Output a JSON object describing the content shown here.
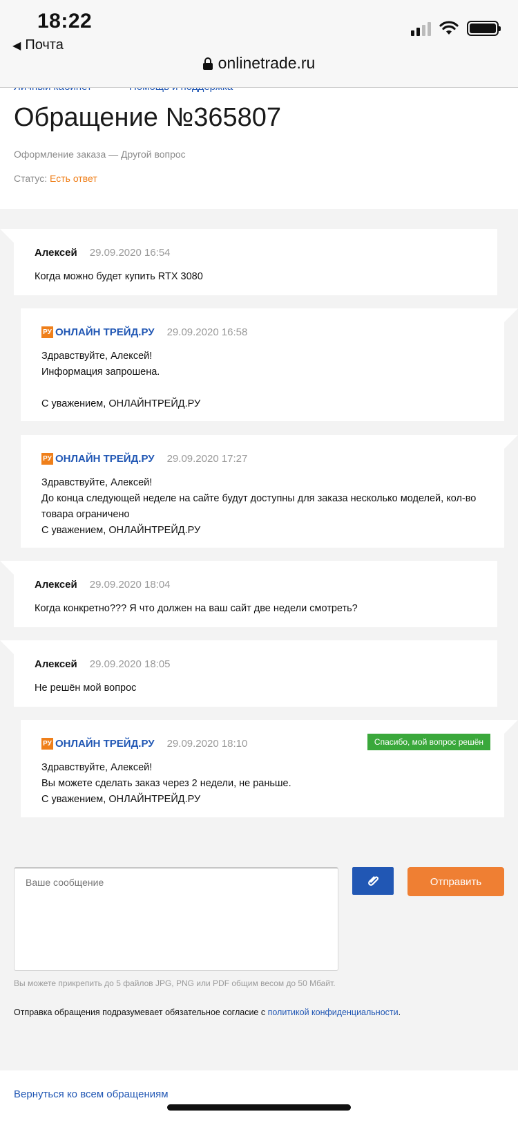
{
  "status_bar": {
    "time": "18:22",
    "back_app": "Почта",
    "url": "onlinetrade.ru"
  },
  "breadcrumbs": [
    "Личный кабинет",
    "Помощь и поддержка"
  ],
  "ticket": {
    "title": "Обращение №365807",
    "subtitle": "Оформление заказа — Другой вопрос",
    "status_label": "Статус:",
    "status_value": "Есть ответ",
    "status_color": "#ef7f1a"
  },
  "messages": [
    {
      "type": "user",
      "author": "Алексей",
      "date": "29.09.2020 16:54",
      "lines": [
        "Когда можно будет купить RTX 3080"
      ]
    },
    {
      "type": "support",
      "logo": "РУ",
      "author": "ОНЛАЙН ТРЕЙД.РУ",
      "date": "29.09.2020 16:58",
      "lines": [
        "Здравствуйте, Алексей!",
        "Информация запрошена.",
        "",
        "С уважением, ОНЛАЙНТРЕЙД.РУ"
      ]
    },
    {
      "type": "support",
      "logo": "РУ",
      "author": "ОНЛАЙН ТРЕЙД.РУ",
      "date": "29.09.2020 17:27",
      "lines": [
        "Здравствуйте, Алексей!",
        "До конца следующей неделе на сайте будут доступны для заказа несколько моделей, кол-во товара ограничено",
        "С уважением, ОНЛАЙНТРЕЙД.РУ"
      ]
    },
    {
      "type": "user",
      "author": "Алексей",
      "date": "29.09.2020 18:04",
      "lines": [
        "Когда конкретно??? Я что должен на ваш сайт две недели смотреть?"
      ]
    },
    {
      "type": "user",
      "author": "Алексей",
      "date": "29.09.2020 18:05",
      "lines": [
        "Не решён мой вопрос"
      ]
    },
    {
      "type": "support",
      "logo": "РУ",
      "author": "ОНЛАЙН ТРЕЙД.РУ",
      "date": "29.09.2020 18:10",
      "badge": "Спасибо, мой вопрос решён",
      "lines": [
        "Здравствуйте, Алексей!",
        "Вы можете сделать заказ через 2 недели, не раньше.",
        "С уважением, ОНЛАЙНТРЕЙД.РУ"
      ]
    }
  ],
  "form": {
    "placeholder": "Ваше сообщение",
    "send_label": "Отправить",
    "attach_icon": "paperclip-icon",
    "hint": "Вы можете прикрепить до 5 файлов JPG, PNG или PDF общим весом до 50 Мбайт.",
    "consent_text": "Отправка обращения подразумевает обязательное согласие с ",
    "consent_link": "политикой конфиденциальности",
    "consent_end": "."
  },
  "footer": {
    "back_link": "Вернуться ко всем обращениям"
  },
  "colors": {
    "accent_blue": "#2157b4",
    "accent_orange": "#ef7f33",
    "success_green": "#3aa83b"
  }
}
